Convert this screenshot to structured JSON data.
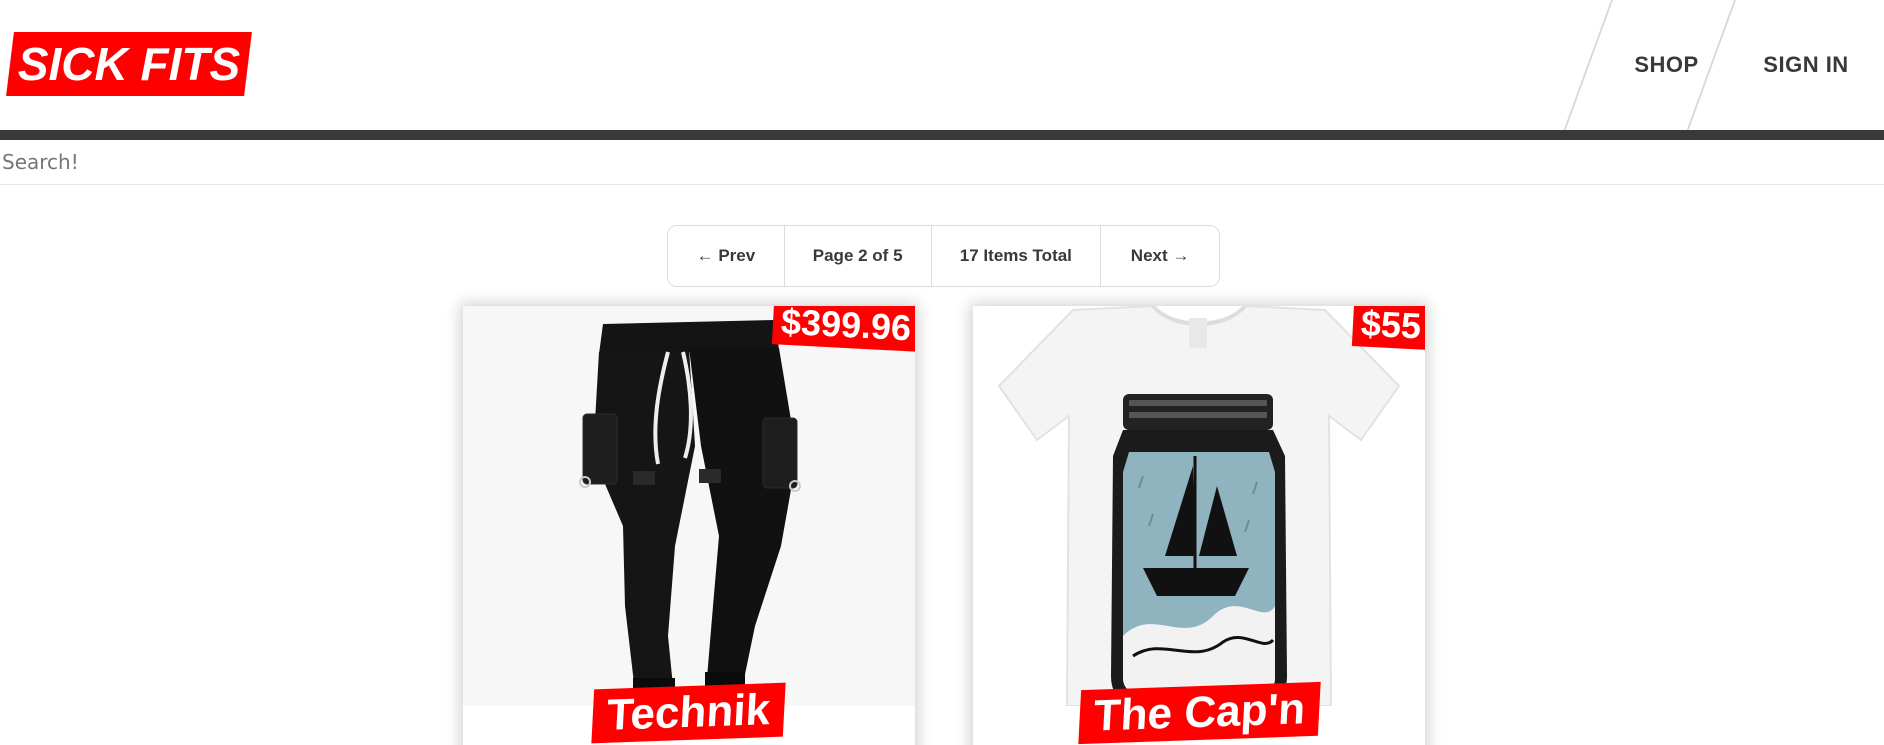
{
  "header": {
    "logo": "SICK FITS",
    "nav": {
      "shop": "SHOP",
      "sign_in": "SIGN IN"
    }
  },
  "search": {
    "placeholder": "Search!",
    "value": ""
  },
  "pagination": {
    "prev": "← Prev",
    "page": "Page 2 of 5",
    "total": "17 Items Total",
    "next": "Next →"
  },
  "products": [
    {
      "title": "Technik",
      "price": "$399.96",
      "image": "black-cargo-pants"
    },
    {
      "title": "The Cap'n",
      "price": "$55",
      "image": "ship-in-jar-tshirt"
    }
  ],
  "colors": {
    "accent": "#ff0000",
    "text": "#393939",
    "bar": "#393939"
  }
}
